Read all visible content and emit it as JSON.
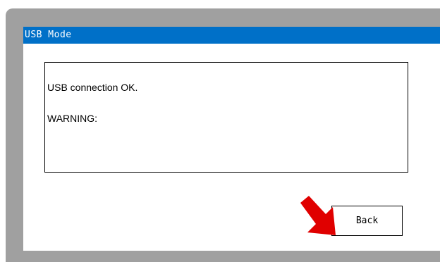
{
  "window": {
    "title": "USB Mode"
  },
  "message": {
    "line1": "USB connection OK.",
    "line2": "WARNING:"
  },
  "buttons": {
    "back_label": "Back"
  },
  "colors": {
    "titlebar": "#0070c8",
    "frame": "#a0a0a0",
    "arrow": "#e00000"
  },
  "icons": {
    "pointer": "red-arrow-icon"
  }
}
